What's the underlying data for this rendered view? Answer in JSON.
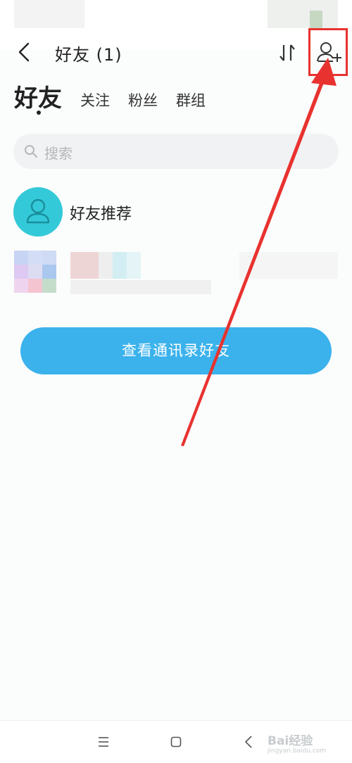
{
  "header": {
    "title": "好友 (1)"
  },
  "tabs": {
    "active": "好友",
    "items": [
      "关注",
      "粉丝",
      "群组"
    ]
  },
  "search": {
    "placeholder": "搜索"
  },
  "recommend": {
    "label": "好友推荐"
  },
  "contacts_button": {
    "label": "查看通讯录好友"
  },
  "watermark": {
    "brand": "Bai经验",
    "site": "jingyan.baidu.com"
  },
  "colors": {
    "accent": "#3bb2ec",
    "avatar": "#33c9d8",
    "annotation": "#e8322f"
  },
  "icons": {
    "back": "chevron-left-icon",
    "sort": "sort-icon",
    "add_friend": "add-user-icon",
    "search": "search-icon",
    "avatar": "person-icon"
  }
}
